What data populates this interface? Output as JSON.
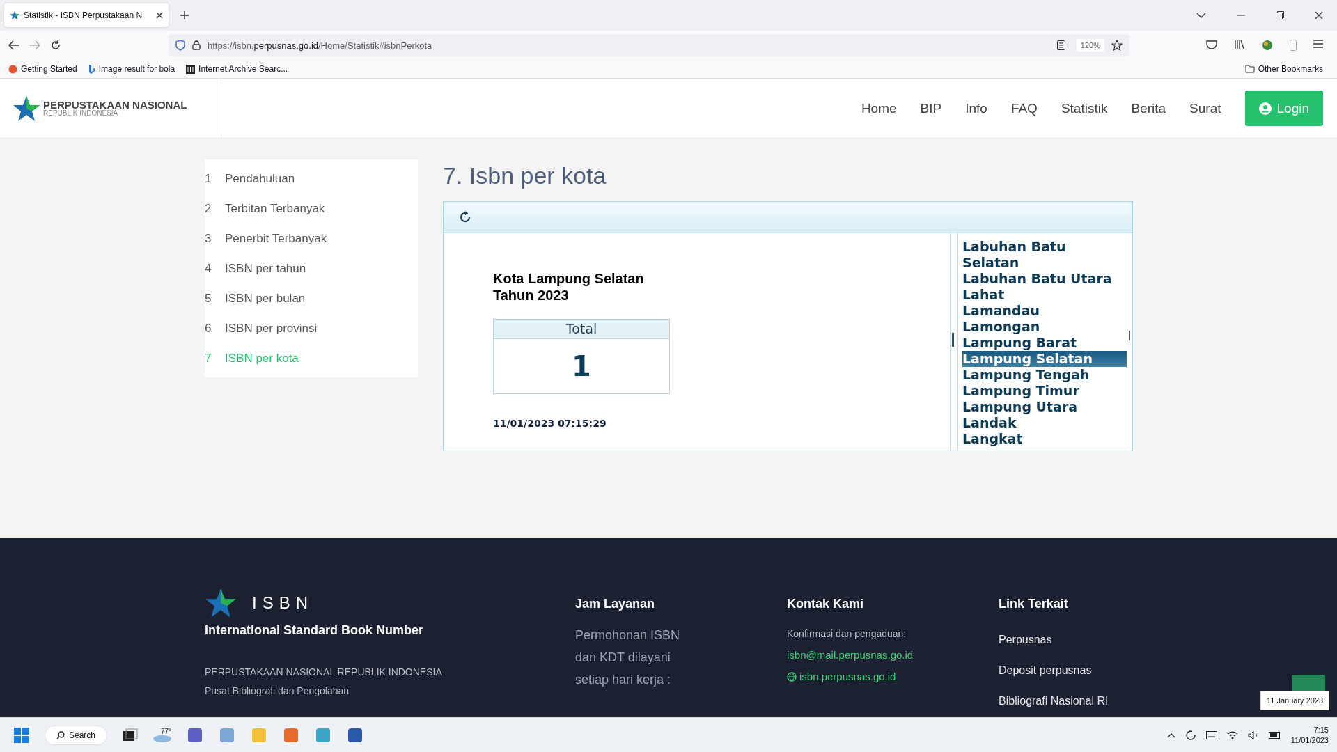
{
  "browser": {
    "tab_title": "Statistik - ISBN Perpustakaan N",
    "url_prefix": "https://isbn.",
    "url_domain": "perpusnas.go.id",
    "url_path": "/Home/Statistik#isbnPerkota",
    "zoom": "120%",
    "bookmarks": [
      "Getting Started",
      "Image result for bola",
      "Internet Archive Searc..."
    ],
    "other_bookmarks": "Other Bookmarks"
  },
  "site": {
    "logo_title": "PERPUSTAKAAN NASIONAL",
    "logo_subtitle": "REPUBLIK INDONESIA",
    "nav": [
      "Home",
      "BIP",
      "Info",
      "FAQ",
      "Statistik",
      "Berita",
      "Surat"
    ],
    "login": "Login"
  },
  "sidebar": [
    {
      "number": "1",
      "label": "Pendahuluan",
      "selected": false
    },
    {
      "number": "2",
      "label": "Terbitan Terbanyak",
      "selected": false
    },
    {
      "number": "3",
      "label": "Penerbit Terbanyak",
      "selected": false
    },
    {
      "number": "4",
      "label": "ISBN per tahun",
      "selected": false
    },
    {
      "number": "5",
      "label": "ISBN per bulan",
      "selected": false
    },
    {
      "number": "6",
      "label": "ISBN per provinsi",
      "selected": false
    },
    {
      "number": "7",
      "label": "ISBN per kota",
      "selected": true
    }
  ],
  "section": {
    "title": "7. Isbn per kota",
    "heading_lines": [
      "Kota Lampung Selatan",
      "Tahun 2023"
    ],
    "total_label": "Total",
    "total_value": "1",
    "timestamp": "11/01/2023 07:15:29",
    "cities": [
      {
        "name": "Labuhan Batu Selatan",
        "selected": false
      },
      {
        "name": "Labuhan Batu Utara",
        "selected": false
      },
      {
        "name": "Lahat",
        "selected": false
      },
      {
        "name": "Lamandau",
        "selected": false
      },
      {
        "name": "Lamongan",
        "selected": false
      },
      {
        "name": "Lampung Barat",
        "selected": false
      },
      {
        "name": "Lampung Selatan",
        "selected": true
      },
      {
        "name": "Lampung Tengah",
        "selected": false
      },
      {
        "name": "Lampung Timur",
        "selected": false
      },
      {
        "name": "Lampung Utara",
        "selected": false
      },
      {
        "name": "Landak",
        "selected": false
      },
      {
        "name": "Langkat",
        "selected": false
      }
    ]
  },
  "footer": {
    "brand": "ISBN",
    "tagline": "International Standard Book Number",
    "org_lines": [
      "PERPUSTAKAAN NASIONAL REPUBLIK INDONESIA",
      "Pusat Bibliografi dan Pengolahan"
    ],
    "hours": {
      "title": "Jam Layanan",
      "lines": [
        "Permohonan ISBN",
        "dan KDT dilayani",
        "setiap hari kerja :"
      ]
    },
    "contact": {
      "title": "Kontak Kami",
      "note": "Konfirmasi dan pengaduan:",
      "email": "isbn@mail.perpusnas.go.id",
      "website": "isbn.perpusnas.go.id"
    },
    "links": {
      "title": "Link Terkait",
      "items": [
        "Perpusnas",
        "Deposit perpusnas",
        "Bibliografi Nasional RI"
      ]
    }
  },
  "taskbar": {
    "search": "Search",
    "weather": "77°",
    "time": "7:15",
    "date": "11/01/2023",
    "tooltip": "11 January 2023"
  }
}
